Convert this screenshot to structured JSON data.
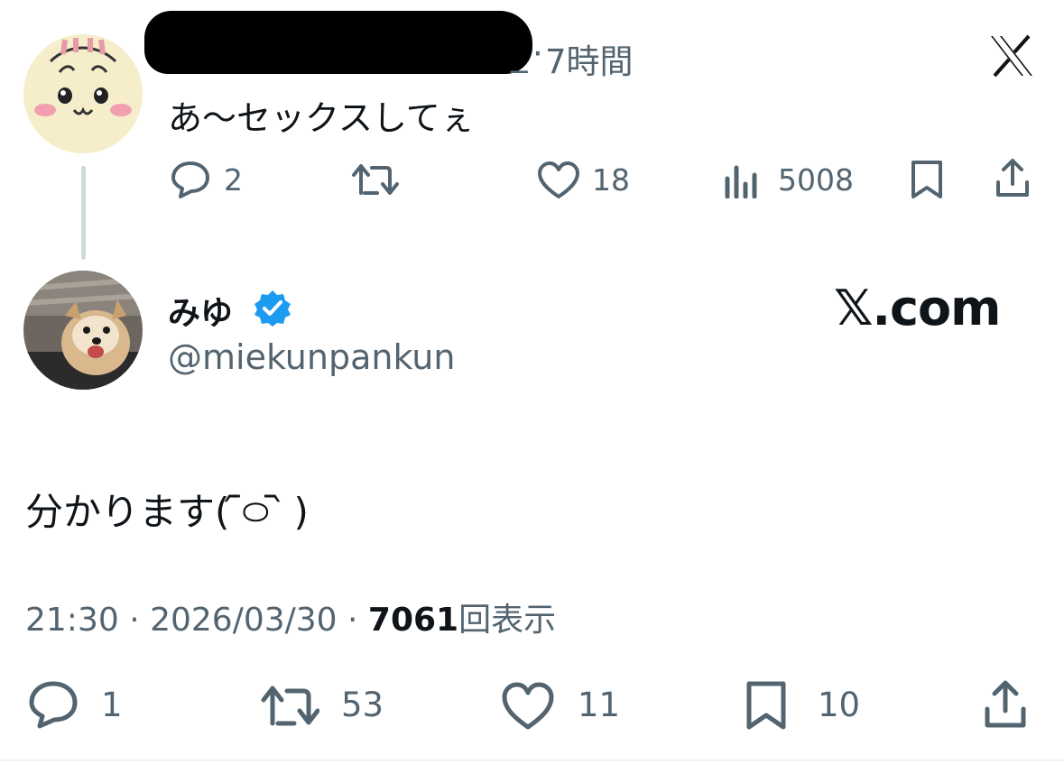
{
  "parent_tweet": {
    "handle_tail": "_",
    "separator": "·",
    "time_ago": "7時間",
    "text": "あ〜セックスしてぇ",
    "actions": {
      "reply_count": "2",
      "retweet_count": "",
      "like_count": "18",
      "views_count": "5008"
    },
    "platform_icon": "x-logo-icon"
  },
  "main_tweet": {
    "display_name": "みゆ",
    "handle": "@miekunpankun",
    "verified": true,
    "brand_text": "𝕏.com",
    "text": "分かります( ᷇࿀ ᷆ )",
    "timestamp": "21:30 · 2026/03/30 · ",
    "view_count": "7061",
    "view_label": "回表示",
    "actions": {
      "reply_count": "1",
      "retweet_count": "53",
      "like_count": "11",
      "bookmark_count": "10"
    }
  },
  "colors": {
    "text": "#0f1419",
    "secondary": "#536471",
    "verified": "#1d9bf0",
    "thread_line": "#cfd9de"
  }
}
